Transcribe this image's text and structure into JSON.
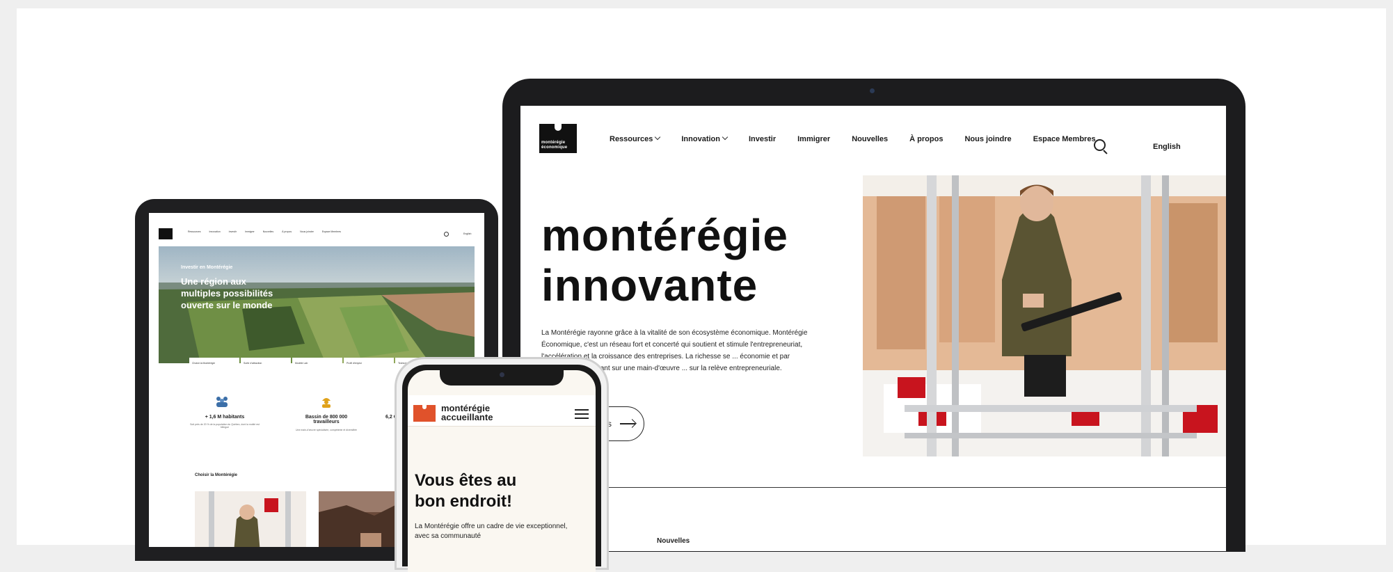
{
  "laptop": {
    "logo_text": "montérégie\néconomique",
    "nav": [
      {
        "label": "Ressources",
        "dropdown": true
      },
      {
        "label": "Innovation",
        "dropdown": true
      },
      {
        "label": "Investir",
        "dropdown": false
      },
      {
        "label": "Immigrer",
        "dropdown": false
      },
      {
        "label": "Nouvelles",
        "dropdown": false
      },
      {
        "label": "À propos",
        "dropdown": false
      },
      {
        "label": "Nous joindre",
        "dropdown": false
      },
      {
        "label": "Espace Membres",
        "dropdown": false
      }
    ],
    "search_icon": "search-icon",
    "language": "English",
    "hero_title_line1": "montérégie",
    "hero_title_line2": "innovante",
    "hero_text": "La Montérégie rayonne grâce à la vitalité de son écosystème économique. Montérégie Économique, c'est un réseau fort et concerté qui soutient et stimule l'entrepreneuriat, l'accélération et la croissance des entreprises. La richesse se ... économie et par l'innovation, en misant sur une main-d'œuvre ... sur la relève entrepreneuriale.",
    "more_button": "plus",
    "news_label": "Nouvelles"
  },
  "tablet": {
    "nav": [
      "Ressources",
      "Innovation",
      "Investir",
      "Immigrer",
      "Nouvelles",
      "À propos",
      "Nous joindre",
      "Espace Membres"
    ],
    "language": "English",
    "hero_kicker": "Investir en Montérégie",
    "hero_title": "Une région aux\nmultiples possibilités\nouverte sur le monde",
    "tabs": [
      "Choisir la Montérégie",
      "Sortir d'attraction",
      "Modèle Lab",
      "Profil d'emploi",
      "Technologies"
    ],
    "stats": [
      {
        "title": "+ 1,6 M habitants",
        "sub": "Soit près de 20 % de la population du Québec, dont la moitié est bilingue"
      },
      {
        "title": "Bassin de 800 000\ntravailleurs",
        "sub": "Une main-d'œuvre spécialisée, compétente et diversifiée"
      },
      {
        "title": "6,2 G",
        "sub": ""
      }
    ],
    "section_title": "Choisir la Montérégie"
  },
  "phone": {
    "brand": "montérégie\naccueillante",
    "title": "Vous êtes au\nbon endroit!",
    "text": "La Montérégie offre un cadre de vie exceptionnel, avec sa communauté"
  },
  "colors": {
    "brand_orange": "#e0522b",
    "dark": "#111111",
    "page_bg": "#efefef"
  }
}
